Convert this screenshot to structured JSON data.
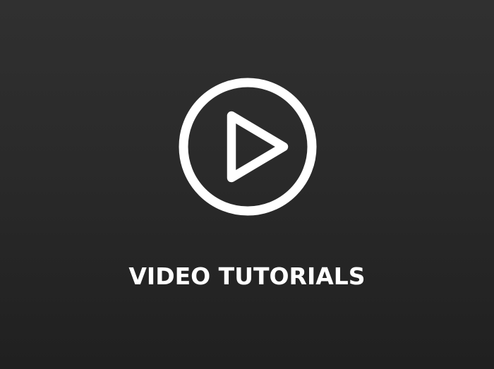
{
  "card": {
    "title": "VIDEO TUTORIALS",
    "icon": "play-circle-icon"
  },
  "colors": {
    "background_top": "#303030",
    "background_bottom": "#202020",
    "foreground": "#ffffff"
  }
}
